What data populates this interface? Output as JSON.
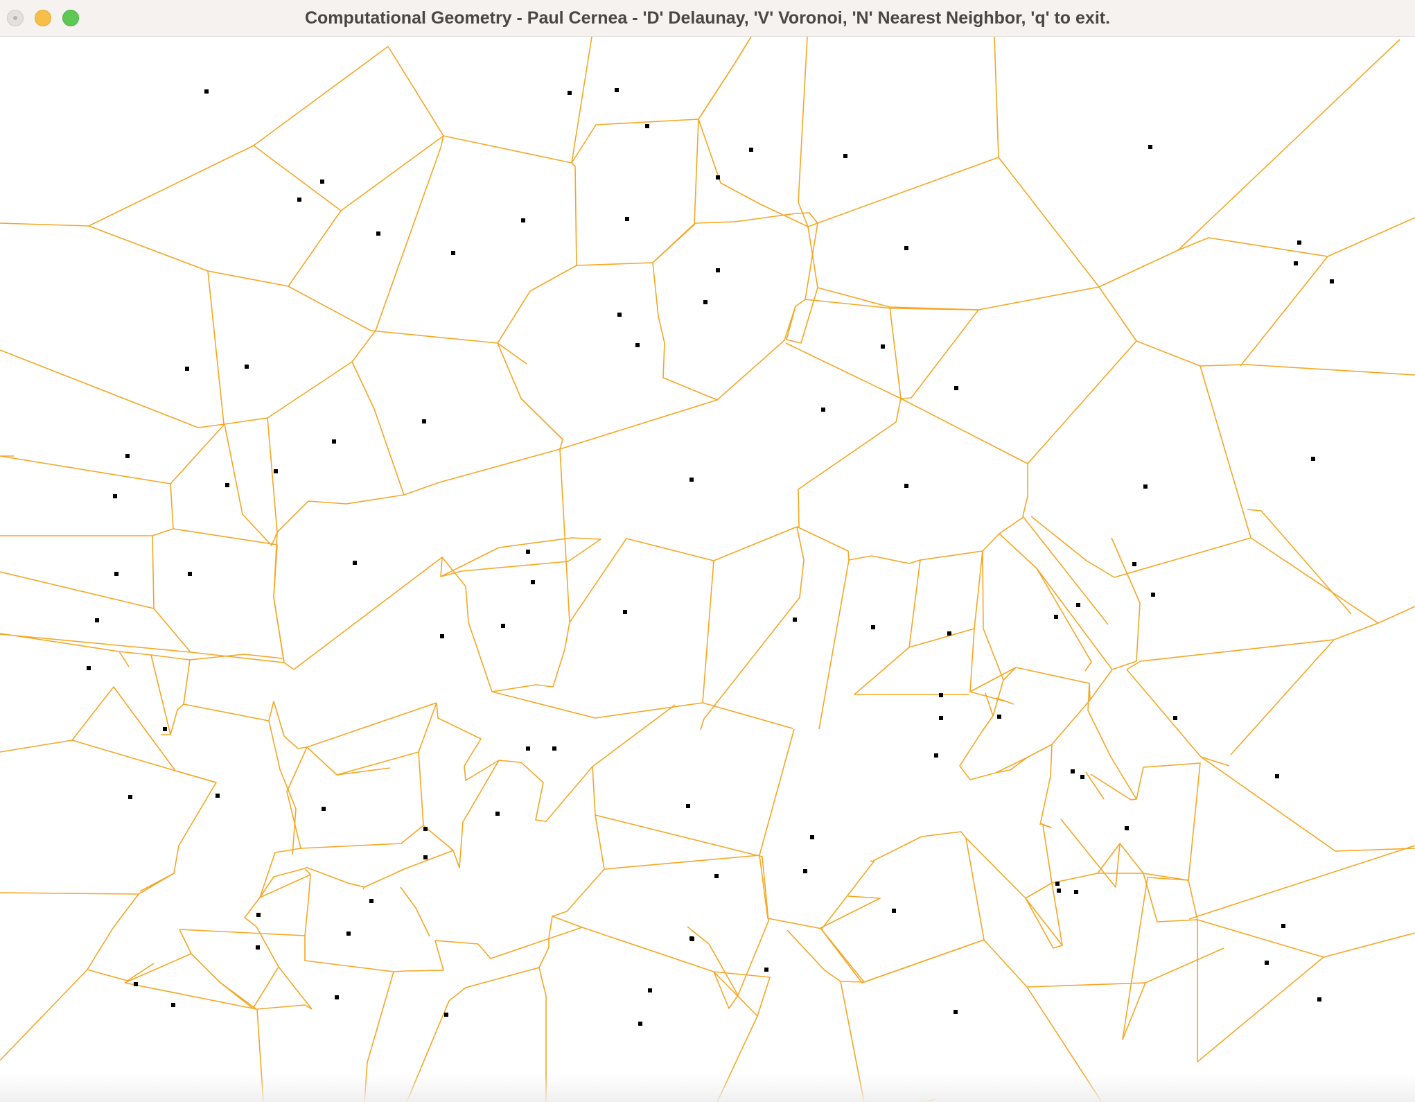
{
  "window": {
    "title": "Computational Geometry - Paul Cernea - 'D' Delaunay, 'V' Voronoi, 'N' Nearest Neighbor, 'q' to exit.",
    "controls": {
      "close": "close-button",
      "minimize": "minimize-button",
      "maximize": "zoom-button"
    }
  },
  "canvas": {
    "mode": "Voronoi",
    "edge_color": "#f5a623",
    "site_color": "#000000",
    "background": "#ffffff"
  }
}
